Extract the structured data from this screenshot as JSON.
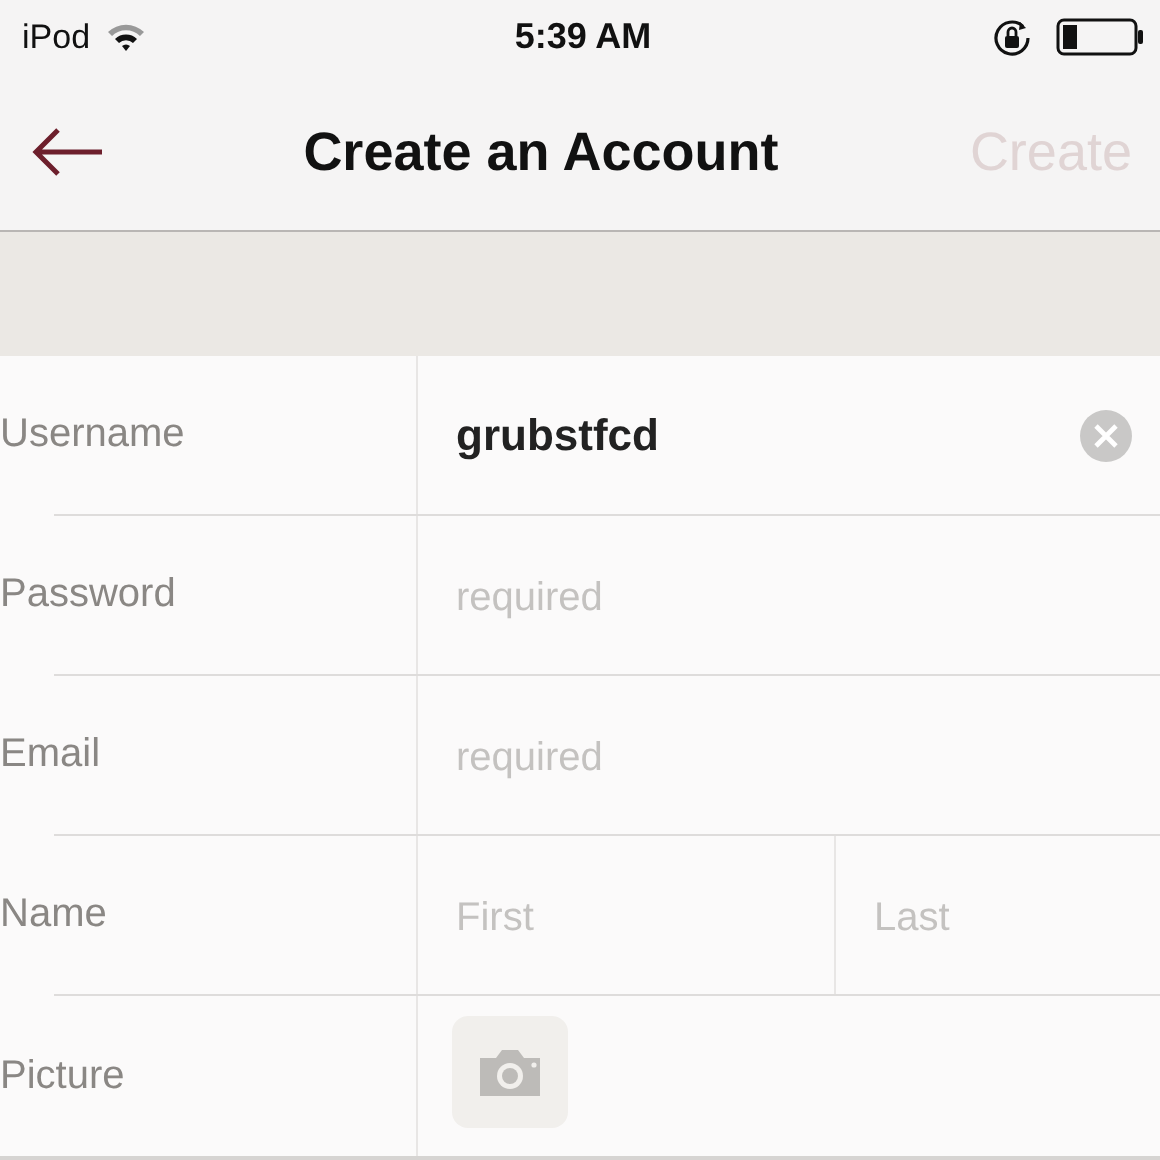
{
  "status_bar": {
    "carrier": "iPod",
    "time": "5:39 AM"
  },
  "nav": {
    "title": "Create an Account",
    "action": {
      "label": "Create",
      "disabled": true
    }
  },
  "form": {
    "rows": [
      {
        "kind": "text",
        "label": "Username",
        "value": "grubstfcd"
      },
      {
        "kind": "text",
        "label": "Password",
        "placeholder": "required"
      },
      {
        "kind": "text",
        "label": "Email",
        "placeholder": "required"
      },
      {
        "kind": "split",
        "label": "Name",
        "fields": [
          {
            "placeholder": "First"
          },
          {
            "placeholder": "Last"
          }
        ]
      },
      {
        "kind": "picture",
        "label": "Picture"
      }
    ]
  }
}
